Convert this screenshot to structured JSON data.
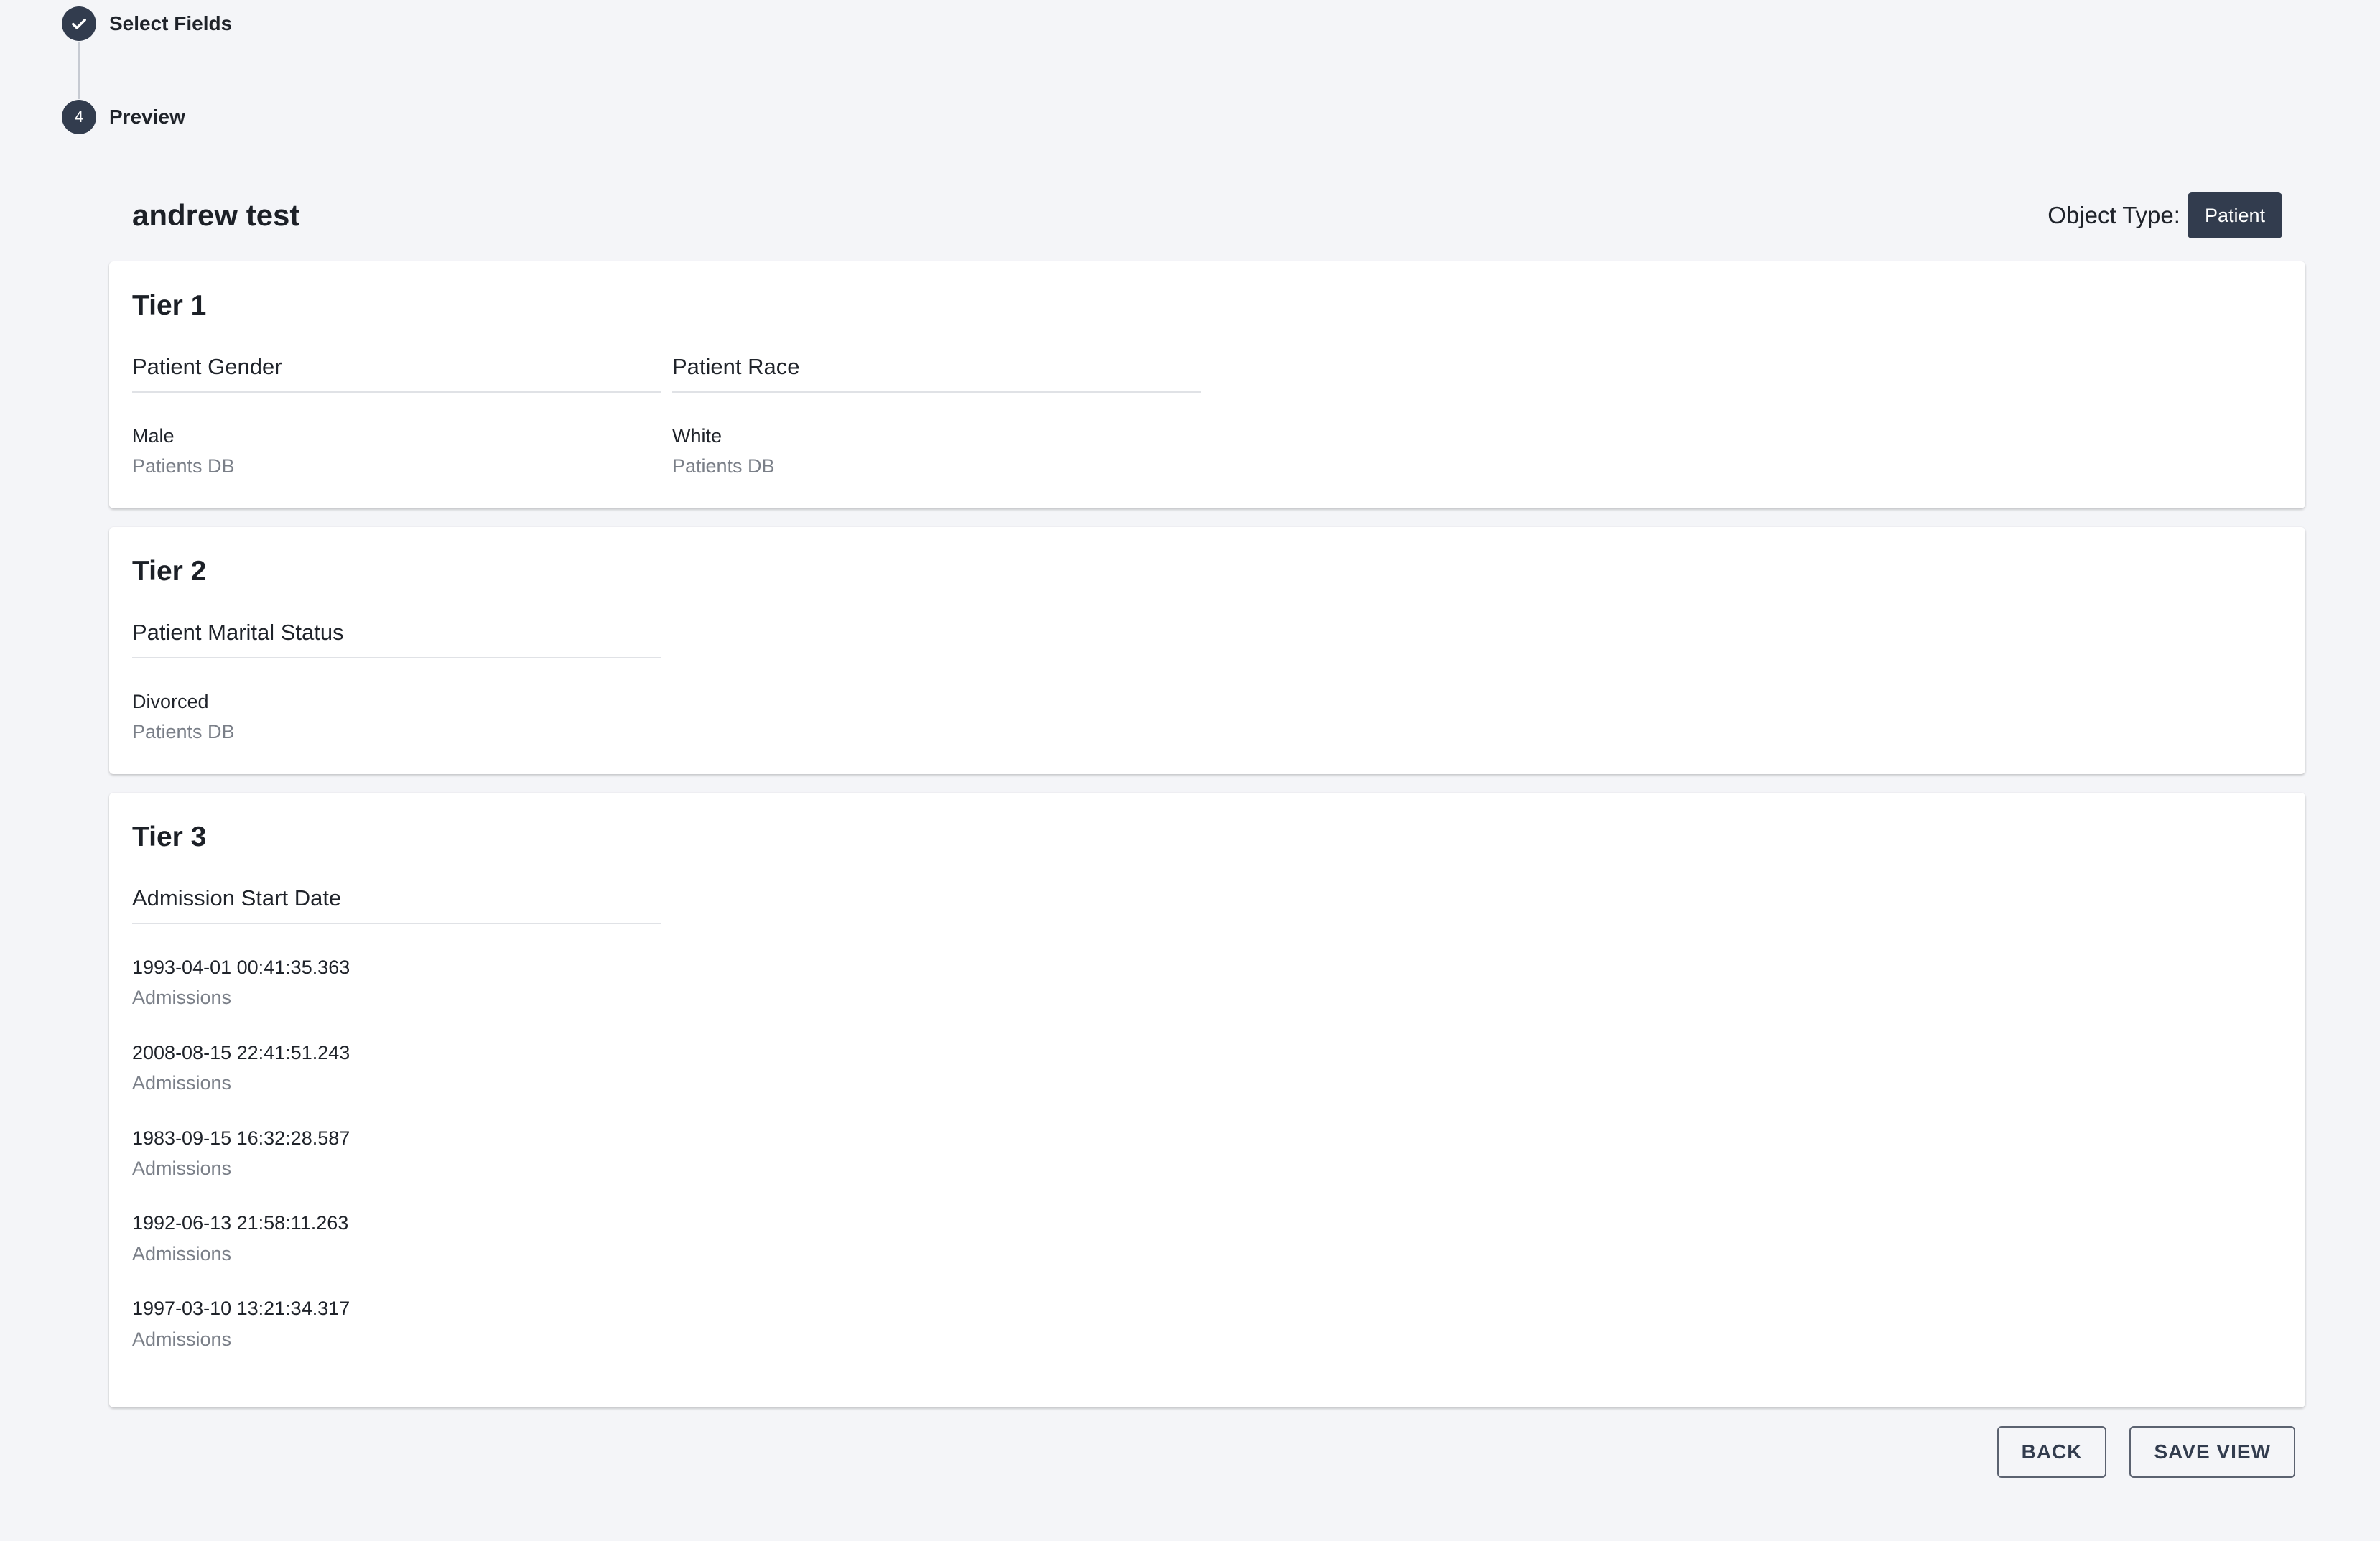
{
  "stepper": {
    "steps": [
      {
        "label": "Select Fields",
        "status": "completed",
        "icon": "check-icon"
      },
      {
        "label": "Preview",
        "status": "active",
        "number": "4"
      }
    ]
  },
  "header": {
    "title": "andrew test",
    "object_type_label": "Object Type:",
    "object_type_value": "Patient"
  },
  "tiers": [
    {
      "title": "Tier 1",
      "fields": [
        {
          "name": "Patient Gender",
          "values": [
            {
              "value": "Male",
              "source": "Patients DB"
            }
          ]
        },
        {
          "name": "Patient Race",
          "values": [
            {
              "value": "White",
              "source": "Patients DB"
            }
          ]
        }
      ]
    },
    {
      "title": "Tier 2",
      "fields": [
        {
          "name": "Patient Marital Status",
          "values": [
            {
              "value": "Divorced",
              "source": "Patients DB"
            }
          ]
        }
      ]
    },
    {
      "title": "Tier 3",
      "fields": [
        {
          "name": "Admission Start Date",
          "values": [
            {
              "value": "1993-04-01 00:41:35.363",
              "source": "Admissions"
            },
            {
              "value": "2008-08-15 22:41:51.243",
              "source": "Admissions"
            },
            {
              "value": "1983-09-15 16:32:28.587",
              "source": "Admissions"
            },
            {
              "value": "1992-06-13 21:58:11.263",
              "source": "Admissions"
            },
            {
              "value": "1997-03-10 13:21:34.317",
              "source": "Admissions"
            }
          ]
        }
      ]
    }
  ],
  "actions": {
    "back_label": "BACK",
    "save_label": "SAVE VIEW"
  },
  "colors": {
    "background": "#f4f5f8",
    "accent": "#323c4e",
    "secondary_text": "#7a7f88"
  }
}
